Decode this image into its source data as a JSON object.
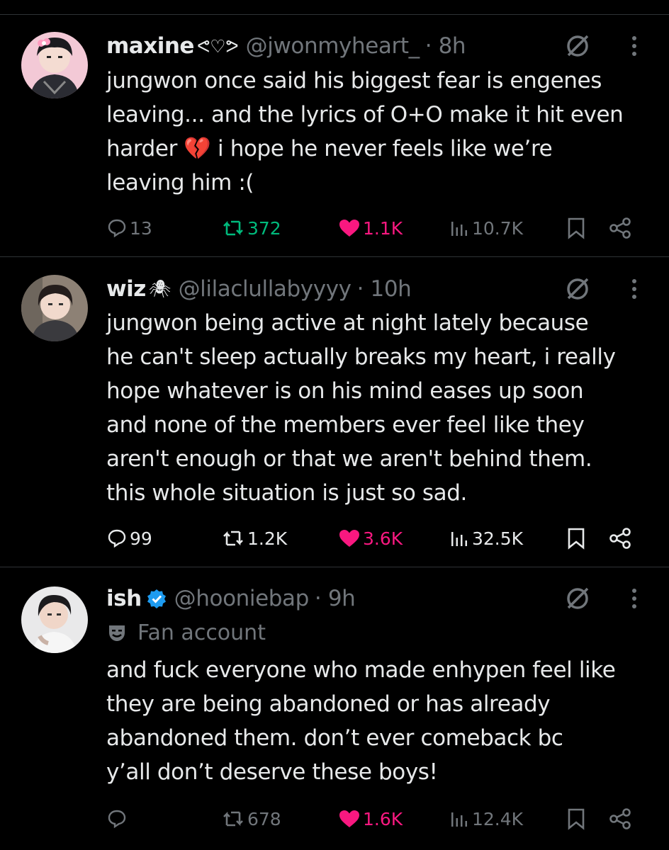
{
  "colors": {
    "background": "#000000",
    "text": "#e7e9ea",
    "muted": "#71767b",
    "retweet": "#00ba7c",
    "like": "#f91880",
    "verified": "#1d9bf0",
    "divider": "#2f3336"
  },
  "tweets": [
    {
      "name": "maxine",
      "name_decoration": "ᕙ♡ᕗ",
      "handle": "@jwonmyheart_",
      "time": "· 8h",
      "text": "jungwon once said his biggest fear is engenes\nleaving... and the lyrics of O+O make it hit even\nharder 💔 i hope he never feels like we’re\nleaving him :(",
      "replies": "13",
      "retweets": "372",
      "likes": "1.1K",
      "views": "10.7K",
      "retweeted": true,
      "liked": true
    },
    {
      "name": "wiz",
      "name_decoration": "🕷",
      "handle": "@lilaclullabyyyy",
      "time": "· 10h",
      "text": "jungwon being active at night lately because\nhe can't sleep actually breaks my heart, i really\nhope whatever is on his mind eases up soon\nand none of the members ever feel like they\naren't enough or that we aren't behind them.\nthis whole situation is just so sad.",
      "replies": "99",
      "retweets": "1.2K",
      "likes": "3.6K",
      "views": "32.5K",
      "retweeted": false,
      "liked": true
    },
    {
      "name": "ish",
      "handle": "@hooniebap",
      "time": "· 9h",
      "verified": true,
      "label_icon": "theater-mask-icon",
      "label": "Fan account",
      "text": "and fuck everyone who made enhypen feel like\nthey are being abandoned or has already\nabandoned them. don’t ever comeback bc\ny’all don’t deserve these boys!",
      "replies": "",
      "retweets": "678",
      "likes": "1.6K",
      "views": "12.4K",
      "retweeted": false,
      "liked": true
    }
  ]
}
